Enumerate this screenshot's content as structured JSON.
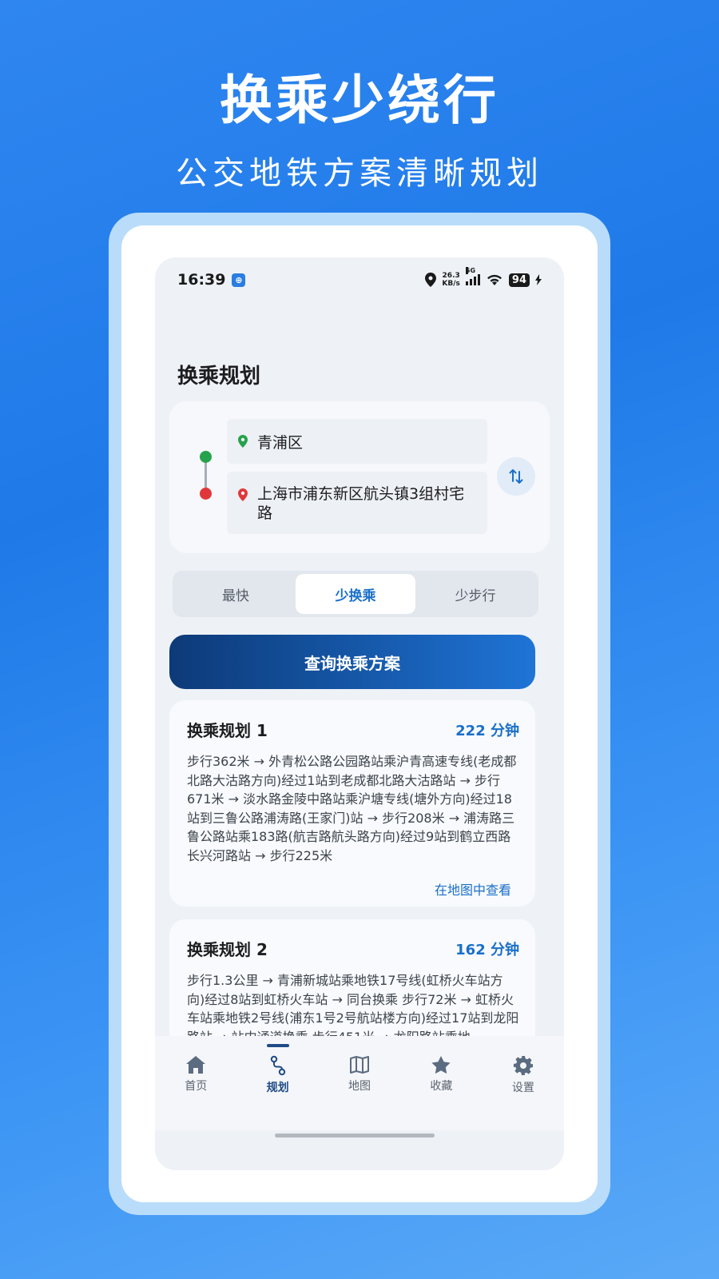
{
  "promo": {
    "headline": "换乘少绕行",
    "subline": "公交地铁方案清晰规划"
  },
  "statusbar": {
    "time": "16:39",
    "net_speed_value": "26.3",
    "net_speed_unit": "KB/s",
    "network": "5G",
    "battery": "94"
  },
  "page": {
    "title": "换乘规划"
  },
  "route": {
    "start": "青浦区",
    "end": "上海市浦东新区航头镇3组村宅路"
  },
  "segments": [
    {
      "label": "最快",
      "active": false
    },
    {
      "label": "少换乘",
      "active": true
    },
    {
      "label": "少步行",
      "active": false
    }
  ],
  "query_button": "查询换乘方案",
  "plans": [
    {
      "title": "换乘规划 1",
      "duration": "222 分钟",
      "description": "步行362米 → 外青松公路公园路站乘沪青高速专线(老成都北路大沽路方向)经过1站到老成都北路大沽路站 → 步行671米 → 淡水路金陵中路站乘沪塘专线(塘外方向)经过18站到三鲁公路浦涛路(王家门)站 → 步行208米 → 浦涛路三鲁公路站乘183路(航吉路航头路方向)经过9站到鹤立西路长兴河路站 → 步行225米",
      "link": "在地图中查看"
    },
    {
      "title": "换乘规划 2",
      "duration": "162 分钟",
      "description": "步行1.3公里 → 青浦新城站乘地铁17号线(虹桥火车站方向)经过8站到虹桥火车站 → 同台换乘 步行72米 → 虹桥火车站乘地铁2号线(浦东1号2号航站楼方向)经过17站到龙阳路站 → 站内通道换乘 步行451米 → 龙阳路站乘地",
      "link": ""
    }
  ],
  "tabbar": [
    {
      "label": "首页",
      "icon": "home-icon",
      "active": false
    },
    {
      "label": "规划",
      "icon": "route-icon",
      "active": true
    },
    {
      "label": "地图",
      "icon": "map-icon",
      "active": false
    },
    {
      "label": "收藏",
      "icon": "star-icon",
      "active": false
    },
    {
      "label": "设置",
      "icon": "gear-icon",
      "active": false
    }
  ],
  "colors": {
    "accent": "#1a6fc9",
    "start_dot": "#25a24b",
    "end_dot": "#e0383a",
    "tab_active": "#1f4b86"
  }
}
